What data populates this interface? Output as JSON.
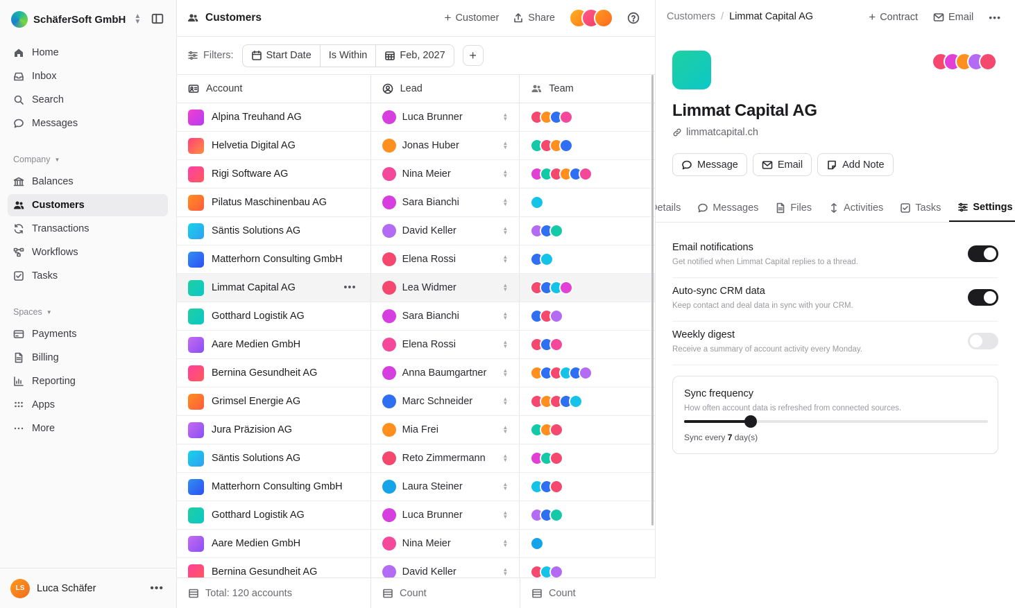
{
  "workspace": {
    "name": "SchäferSoft GmbH"
  },
  "nav": [
    {
      "label": "Home",
      "icon": "home-icon"
    },
    {
      "label": "Inbox",
      "icon": "inbox-icon"
    },
    {
      "label": "Search",
      "icon": "search-icon"
    },
    {
      "label": "Messages",
      "icon": "message-icon"
    }
  ],
  "company": {
    "heading": "Company",
    "items": [
      {
        "label": "Balances",
        "icon": "bank-icon",
        "active": false
      },
      {
        "label": "Customers",
        "icon": "users-icon",
        "active": true
      },
      {
        "label": "Transactions",
        "icon": "refresh-icon",
        "active": false
      },
      {
        "label": "Workflows",
        "icon": "workflow-icon",
        "active": false
      },
      {
        "label": "Tasks",
        "icon": "checkbox-icon",
        "active": false
      }
    ]
  },
  "spaces": {
    "heading": "Spaces",
    "items": [
      {
        "label": "Payments",
        "icon": "card-icon"
      },
      {
        "label": "Billing",
        "icon": "document-icon"
      },
      {
        "label": "Reporting",
        "icon": "chart-icon"
      },
      {
        "label": "Apps",
        "icon": "grid-icon"
      },
      {
        "label": "More",
        "icon": "dots-icon"
      }
    ]
  },
  "user": {
    "initials": "LS",
    "name": "Luca Schäfer"
  },
  "list": {
    "title": "Customers",
    "add_label": "Customer",
    "share_label": "Share",
    "filters_label": "Filters:",
    "filter": {
      "field": "Start Date",
      "op": "Is Within",
      "value": "Feb, 2027"
    },
    "columns": {
      "account": "Account",
      "lead": "Lead",
      "team": "Team"
    },
    "footer": {
      "total": "Total: 120 accounts",
      "count1": "Count",
      "count2": "Count"
    }
  },
  "colors": {
    "magenta": "#e23fd6",
    "red": "#f3475f",
    "orange": "#ff8f1f",
    "cyan": "#16c3e8",
    "blue": "#2f6ff2",
    "purple": "#b26bf2",
    "teal": "#14c9a7",
    "pink": "#f4489a"
  },
  "rows": [
    {
      "account": "Alpina Treuhand AG",
      "logo": [
        "#f43fd0",
        "#b33df0"
      ],
      "lead": "Luca Brunner",
      "lead_color": "#d63ee0",
      "team": [
        "#f4486f",
        "#ff8f1f",
        "#2f6ff2",
        "#f4489a"
      ]
    },
    {
      "account": "Helvetia Digital AG",
      "logo": [
        "#ff3f7a",
        "#ff8f3f"
      ],
      "lead": "Jonas Huber",
      "lead_color": "#ff8f1f",
      "team": [
        "#14c9a7",
        "#f4486f",
        "#ff8f1f",
        "#2f6ff2"
      ]
    },
    {
      "account": "Rigi Software AG",
      "logo": [
        "#ff3fa8",
        "#ff5a5a"
      ],
      "lead": "Nina Meier",
      "lead_color": "#f4489a",
      "team": [
        "#e23fd6",
        "#14c9a7",
        "#f4486f",
        "#ff8f1f",
        "#2f6ff2",
        "#f4489a"
      ]
    },
    {
      "account": "Pilatus Maschinenbau AG",
      "logo": [
        "#ff8f1f",
        "#ff5a3f"
      ],
      "lead": "Sara Bianchi",
      "lead_color": "#d63ee0",
      "team": [
        "#16c3e8"
      ]
    },
    {
      "account": "Säntis Solutions AG",
      "logo": [
        "#16d3e8",
        "#2fa0f2"
      ],
      "lead": "David Keller",
      "lead_color": "#b26bf2",
      "team": [
        "#b26bf2",
        "#2f6ff2",
        "#14c9a7"
      ]
    },
    {
      "account": "Matterhorn Consulting GmbH",
      "logo": [
        "#2f8ff2",
        "#2f4ff2"
      ],
      "lead": "Elena Rossi",
      "lead_color": "#f4486f",
      "team": [
        "#2f6ff2",
        "#16c3e8"
      ]
    },
    {
      "account": "Limmat Capital AG",
      "logo": [
        "#1fd0a0",
        "#0cc7c7"
      ],
      "lead": "Lea Widmer",
      "lead_color": "#f4486f",
      "team": [
        "#f4486f",
        "#2f6ff2",
        "#16c3e8",
        "#e23fd6"
      ],
      "selected": true
    },
    {
      "account": "Gotthard Logistik AG",
      "logo": [
        "#1fd0a0",
        "#0cc7c7"
      ],
      "lead": "Sara Bianchi",
      "lead_color": "#d63ee0",
      "team": [
        "#2f6ff2",
        "#f4486f",
        "#b26bf2"
      ]
    },
    {
      "account": "Aare Medien GmbH",
      "logo": [
        "#c46bf2",
        "#8a4ff2"
      ],
      "lead": "Elena Rossi",
      "lead_color": "#f4489a",
      "team": [
        "#f4486f",
        "#2f6ff2",
        "#f4489a"
      ]
    },
    {
      "account": "Bernina Gesundheit AG",
      "logo": [
        "#ff3f9a",
        "#ff5a5a"
      ],
      "lead": "Anna Baumgartner",
      "lead_color": "#d63ee0",
      "team": [
        "#ff8f1f",
        "#2f6ff2",
        "#f4486f",
        "#16c3e8",
        "#2f6ff2",
        "#b26bf2"
      ]
    },
    {
      "account": "Grimsel Energie AG",
      "logo": [
        "#ff8f1f",
        "#ff5a3f"
      ],
      "lead": "Marc Schneider",
      "lead_color": "#2f6ff2",
      "team": [
        "#f4486f",
        "#ff8f1f",
        "#f4486f",
        "#2f6ff2",
        "#16c3e8"
      ]
    },
    {
      "account": "Jura Präzision AG",
      "logo": [
        "#c46bf2",
        "#8a4ff2"
      ],
      "lead": "Mia Frei",
      "lead_color": "#ff8f1f",
      "team": [
        "#14c9a7",
        "#ff8f1f",
        "#f4486f"
      ]
    },
    {
      "account": "Säntis Solutions AG",
      "logo": [
        "#16d3e8",
        "#2fa0f2"
      ],
      "lead": "Reto Zimmermann",
      "lead_color": "#f4486f",
      "team": [
        "#e23fd6",
        "#14c9a7",
        "#f4486f"
      ]
    },
    {
      "account": "Matterhorn Consulting GmbH",
      "logo": [
        "#2f8ff2",
        "#2f4ff2"
      ],
      "lead": "Laura Steiner",
      "lead_color": "#16a3e8",
      "team": [
        "#16c3e8",
        "#2f6ff2",
        "#f4486f"
      ]
    },
    {
      "account": "Gotthard Logistik AG",
      "logo": [
        "#1fd0a0",
        "#0cc7c7"
      ],
      "lead": "Luca Brunner",
      "lead_color": "#d63ee0",
      "team": [
        "#b26bf2",
        "#2f6ff2",
        "#14c9a7"
      ]
    },
    {
      "account": "Aare Medien GmbH",
      "logo": [
        "#c46bf2",
        "#8a4ff2"
      ],
      "lead": "Nina Meier",
      "lead_color": "#f4489a",
      "team": [
        "#16a3e8"
      ]
    },
    {
      "account": "Bernina Gesundheit AG",
      "logo": [
        "#ff3f9a",
        "#ff5a5a"
      ],
      "lead": "David Keller",
      "lead_color": "#b26bf2",
      "team": [
        "#f4486f",
        "#16c3e8",
        "#b26bf2"
      ]
    }
  ],
  "detail": {
    "crumb_parent": "Customers",
    "crumb_current": "Limmat Capital AG",
    "contract_label": "Contract",
    "email_label": "Email",
    "name": "Limmat Capital AG",
    "url": "limmatcapital.ch",
    "team": [
      "#f4486f",
      "#e23fd6",
      "#ff8f1f",
      "#b26bf2",
      "#f4486f"
    ],
    "buttons": {
      "message": "Message",
      "email": "Email",
      "note": "Add Note"
    },
    "tabs": [
      {
        "label": "Details",
        "icon": "details-icon"
      },
      {
        "label": "Messages",
        "icon": "message-icon"
      },
      {
        "label": "Files",
        "icon": "file-icon"
      },
      {
        "label": "Activities",
        "icon": "activity-icon"
      },
      {
        "label": "Tasks",
        "icon": "checkbox-icon"
      },
      {
        "label": "Settings",
        "icon": "sliders-icon"
      }
    ],
    "active_tab": 5,
    "settings": [
      {
        "title": "Email notifications",
        "desc": "Get notified when Limmat Capital replies to a thread.",
        "on": true
      },
      {
        "title": "Auto-sync CRM data",
        "desc": "Keep contact and deal data in sync with your CRM.",
        "on": true
      },
      {
        "title": "Weekly digest",
        "desc": "Receive a summary of account activity every Monday.",
        "on": false
      }
    ],
    "sync": {
      "title": "Sync frequency",
      "desc": "How often account data is refreshed from connected sources.",
      "prefix": "Sync every",
      "value": "7",
      "suffix": "day(s)",
      "fraction": 0.22
    }
  }
}
